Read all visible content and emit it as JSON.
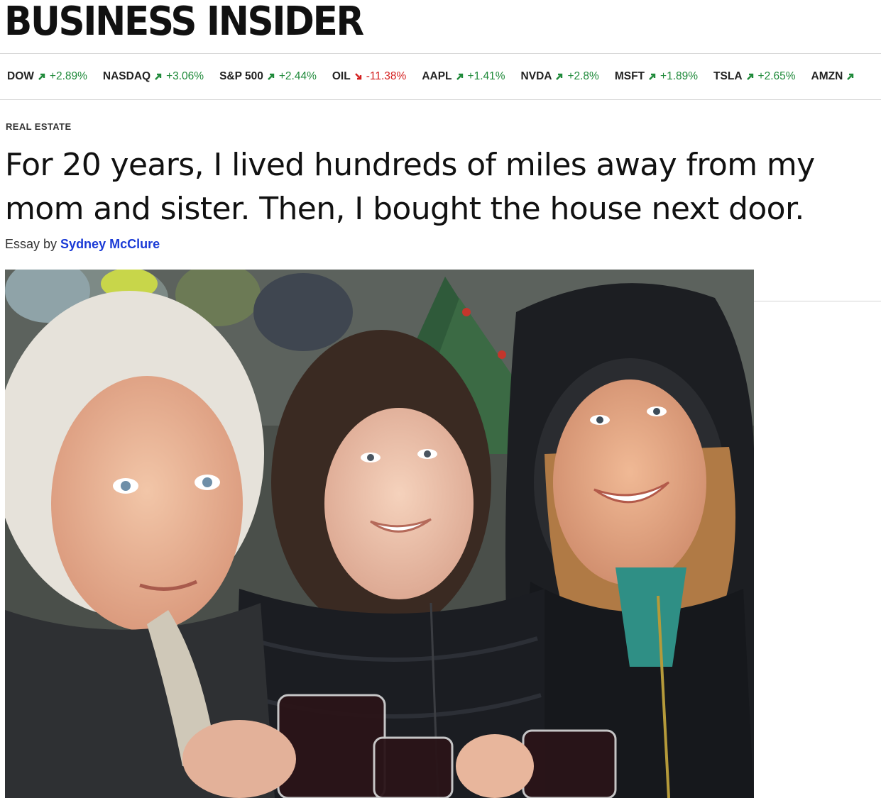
{
  "brand": {
    "logo_text": "BUSINESS INSIDER"
  },
  "ticker": [
    {
      "symbol": "DOW",
      "direction": "up",
      "change": "+2.89%"
    },
    {
      "symbol": "NASDAQ",
      "direction": "up",
      "change": "+3.06%"
    },
    {
      "symbol": "S&P 500",
      "direction": "up",
      "change": "+2.44%"
    },
    {
      "symbol": "OIL",
      "direction": "down",
      "change": "-11.38%"
    },
    {
      "symbol": "AAPL",
      "direction": "up",
      "change": "+1.41%"
    },
    {
      "symbol": "NVDA",
      "direction": "up",
      "change": "+2.8%"
    },
    {
      "symbol": "MSFT",
      "direction": "up",
      "change": "+1.89%"
    },
    {
      "symbol": "TSLA",
      "direction": "up",
      "change": "+2.65%"
    },
    {
      "symbol": "AMZN",
      "direction": "up",
      "change": ""
    }
  ],
  "colors": {
    "up": "#1f8a3a",
    "down": "#d42020",
    "link": "#1a3ad6"
  },
  "article": {
    "category": "REAL ESTATE",
    "headline": "For 20 years, I lived hundreds of miles away from my mom and sister. Then, I bought the house next door.",
    "byline_prefix": "Essay by",
    "author": "Sydney McClure"
  },
  "hero_image": {
    "icon": "hero-photo"
  }
}
